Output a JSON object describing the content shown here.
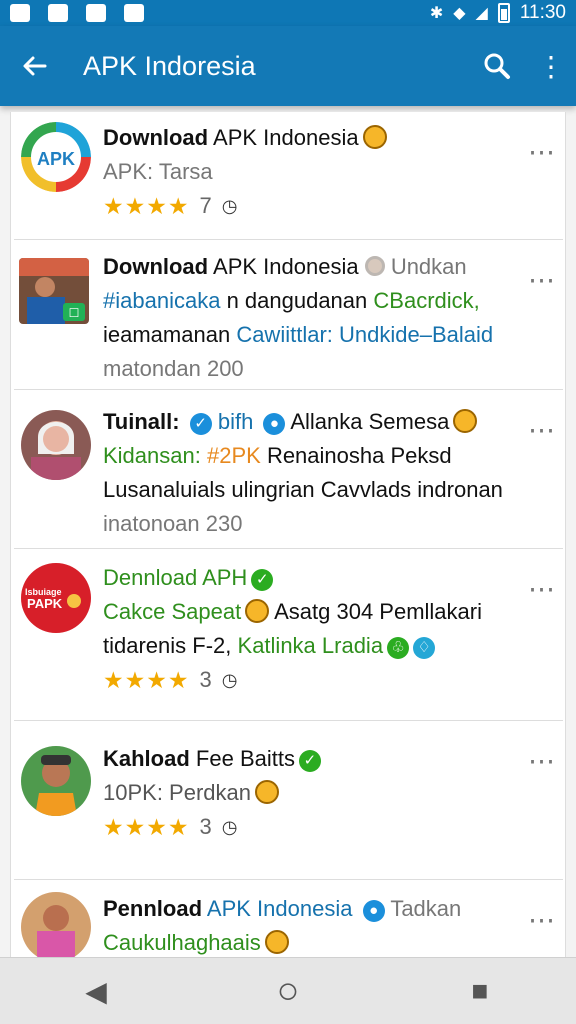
{
  "status_bar": {
    "time": "11:30",
    "left_icons": [
      "gallery-icon",
      "gallery-icon",
      "paw-icon",
      "image-icon"
    ],
    "right_icons": [
      "bluetooth-icon",
      "wifi-icon",
      "signal-icon",
      "battery-icon"
    ]
  },
  "appbar": {
    "title": "APK Indoresia",
    "back_icon": "back-icon",
    "search_icon": "search-icon",
    "menu_icon": "more-vert-icon"
  },
  "items": [
    {
      "title_bold": "Download",
      "title_rest": "APK Indonesia",
      "subtitle": "APK: Tarsa",
      "stars": "★★★★",
      "count": "7",
      "clock": "clock-icon",
      "more": "⋯"
    },
    {
      "title_bold": "Download",
      "title_rest": "APK Indonesia",
      "tail": "Undkan",
      "line2": "#iabanicaka",
      "line2_tail": "n dangudanan",
      "line2_highlight": "CBacrdick,",
      "line3_start": "ieamamanan",
      "line3_blue": "Cawiittlar:",
      "line3_dark": "Undkide–Balaid",
      "line4": "matondan 200",
      "more": "⋯"
    },
    {
      "title_bold": "Tuinall:",
      "title_rest": "bifh",
      "title_tail": "Allanka Semesa",
      "line2": "Kidansan:",
      "line2_orange": "#2PK",
      "line2_tail": "Renainosha Peksd",
      "line3": "Lusanaluials ulingrian Cavvlads indronan",
      "line4": "inatonoan 230",
      "more": "⋯"
    },
    {
      "title": "Dennload APH",
      "line2_green": "Cakce Sapeat",
      "line2_tail": "Asatg 304 Pemllakari",
      "line3_dark": "tidarenis F-2,",
      "line3_green": "Katlinka Lradia",
      "stars": "★★★★",
      "count": "3",
      "clock": "clock-icon",
      "logo_line1": "Isbuiage",
      "logo_line2": "PAPK",
      "more": "⋯"
    },
    {
      "title_bold": "Kahload",
      "title_rest": "Fee Baitts",
      "subtitle": "10PK: Perdkan",
      "stars": "★★★★",
      "count": "3",
      "clock": "clock-icon",
      "more": "⋯"
    },
    {
      "title_bold": "Pennload",
      "title_blue": "APK Indonesia",
      "title_tail": "Tadkan",
      "line2": "Caukulhaghaais",
      "more": "⋯"
    }
  ],
  "nav": {
    "back_label": "◀",
    "home_label": "○",
    "recent_label": "■"
  }
}
